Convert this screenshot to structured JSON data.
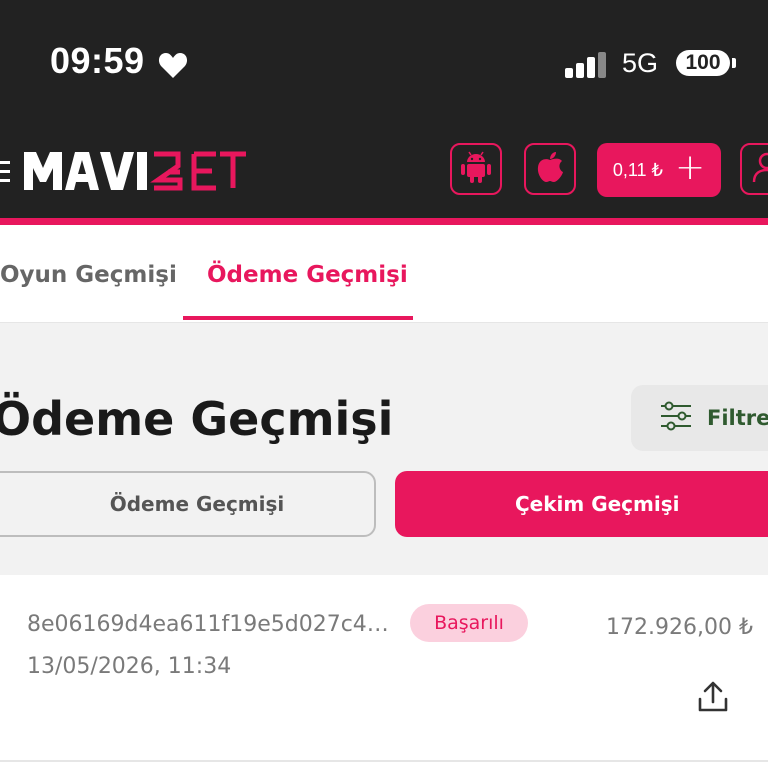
{
  "status_bar": {
    "time": "09:59",
    "network": "5G",
    "battery": "100"
  },
  "header": {
    "logo_text": "MAVIBET",
    "balance": "0,11 ₺",
    "balance_plus": "+"
  },
  "tabs": [
    {
      "label": "Oyun Geçmişi",
      "active": false
    },
    {
      "label": "Ödeme Geçmişi",
      "active": true
    }
  ],
  "page": {
    "title": "Ödeme Geçmişi",
    "filter_label": "Filtre"
  },
  "segments": [
    {
      "label": "Ödeme Geçmişi",
      "active": false
    },
    {
      "label": "Çekim Geçmişi",
      "active": true
    }
  ],
  "transactions": [
    {
      "id": "8e06169d4ea611f19e5d027c4…",
      "date": "13/05/2026, 11:34",
      "status": "Başarılı",
      "amount": "172.926,00 ₺"
    }
  ],
  "colors": {
    "accent": "#e8175d",
    "header_bg": "#222222",
    "content_bg": "#f2f2f2"
  },
  "icons": [
    "heart-icon",
    "signal-icon",
    "menu-icon",
    "android-icon",
    "apple-icon",
    "user-icon",
    "filter-icon",
    "share-icon"
  ]
}
